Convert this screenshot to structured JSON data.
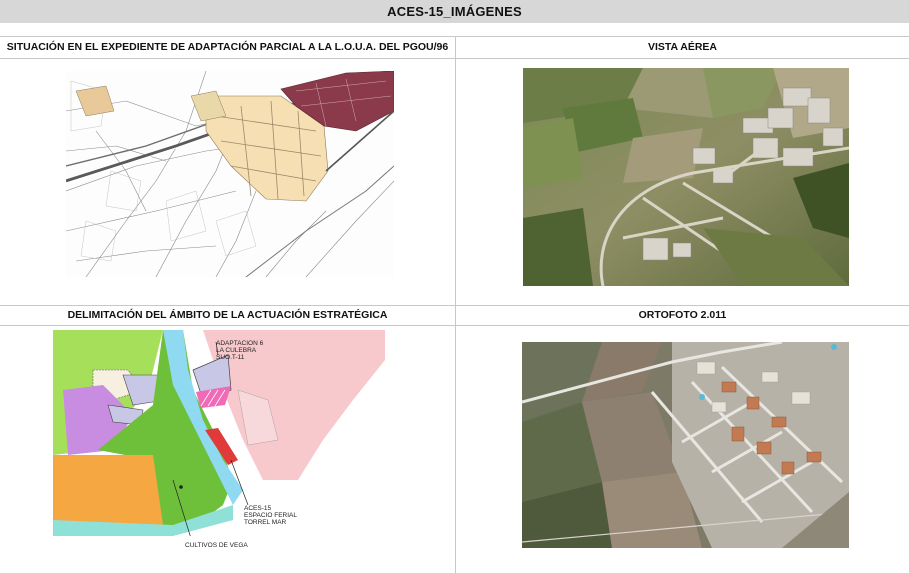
{
  "header": {
    "title": "ACES-15_IMÁGENES"
  },
  "panels": {
    "top_left": {
      "title": "SITUACIÓN EN EL EXPEDIENTE DE ADAPTACIÓN PARCIAL A LA L.O.U.A. DEL PGOU/96",
      "image": "plan-map-image"
    },
    "top_right": {
      "title": "VISTA AÉREA",
      "image": "aerial-photo"
    },
    "bottom_left": {
      "title": "DELIMITACIÓN DEL ÁMBITO DE LA ACTUACIÓN ESTRATÉGICA",
      "image": "zoning-map-image",
      "labels": {
        "adaptacion_1": "ADAPTACION 6",
        "adaptacion_2": "LA CULEBRA",
        "adaptacion_3": "SUO.T-11",
        "aces_1": "ACES-15",
        "aces_2": "ESPACIO FERIAL",
        "aces_3": "TORREL MAR",
        "cultivos": "CULTIVOS DE VEGA"
      }
    },
    "bottom_right": {
      "title": "ORTOFOTO 2.011",
      "image": "orthophoto"
    }
  },
  "colors": {
    "title_bar": "#d7d7d7",
    "grid_line": "#c8c8c8",
    "zone_green": "#6ec03b",
    "zone_lightgreen": "#a6e05a",
    "zone_orange": "#f5a742",
    "zone_pink": "#f7c9cc",
    "zone_purple": "#c88ce0",
    "zone_river": "#8fdaf0",
    "zone_red": "#e03a3a"
  }
}
